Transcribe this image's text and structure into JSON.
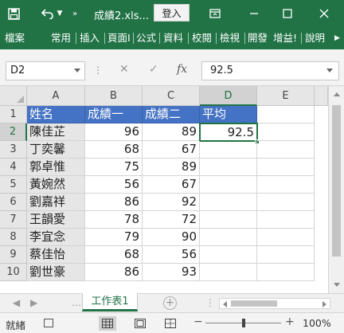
{
  "titlebar": {
    "filename": "成績2.xls...",
    "login_label": "登入"
  },
  "ribbon": {
    "tabs": [
      "檔案",
      "常用",
      "插入",
      "頁面I",
      "公式",
      "資料",
      "校閱",
      "檢視",
      "開發",
      "增益!",
      "說明"
    ]
  },
  "formula_bar": {
    "name_box": "D2",
    "value": "92.5",
    "fx_label": "fx"
  },
  "columns": [
    "A",
    "B",
    "C",
    "D",
    "E"
  ],
  "rows": [
    "1",
    "2",
    "3",
    "4",
    "5",
    "6",
    "7",
    "8",
    "9",
    "10"
  ],
  "table": {
    "headers": [
      "姓名",
      "成績一",
      "成績二",
      "平均"
    ],
    "data": [
      {
        "name": "陳佳芷",
        "s1": "96",
        "s2": "89",
        "avg": "92.5"
      },
      {
        "name": "丁奕馨",
        "s1": "68",
        "s2": "67",
        "avg": ""
      },
      {
        "name": "郭卓惟",
        "s1": "75",
        "s2": "89",
        "avg": ""
      },
      {
        "name": "黃婉然",
        "s1": "56",
        "s2": "67",
        "avg": ""
      },
      {
        "name": "劉嘉祥",
        "s1": "86",
        "s2": "92",
        "avg": ""
      },
      {
        "name": "王韻愛",
        "s1": "78",
        "s2": "72",
        "avg": ""
      },
      {
        "name": "李宜念",
        "s1": "79",
        "s2": "90",
        "avg": ""
      },
      {
        "name": "蔡佳怡",
        "s1": "68",
        "s2": "56",
        "avg": ""
      },
      {
        "name": "劉世豪",
        "s1": "86",
        "s2": "93",
        "avg": ""
      }
    ]
  },
  "active_cell": "D2",
  "sheet_tabs": [
    "工作表1"
  ],
  "status": {
    "ready": "就緒",
    "zoom": "100%"
  },
  "colors": {
    "excel_green": "#217346",
    "header_blue": "#4472c4",
    "name_gray": "#e7e6e6"
  }
}
